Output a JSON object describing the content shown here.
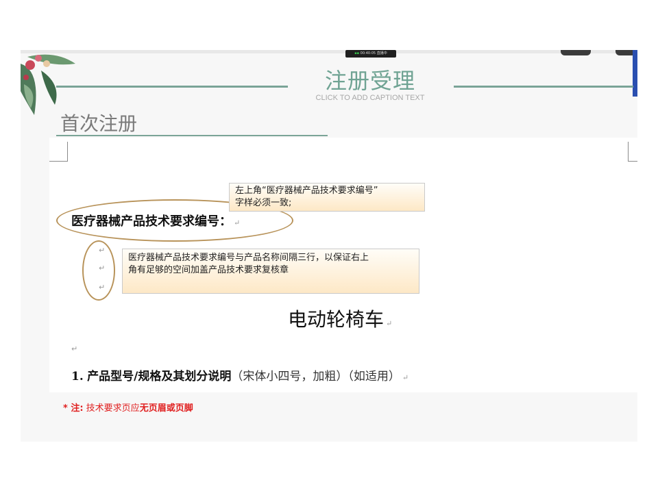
{
  "recording": {
    "time": "00:40:05",
    "status": "直播中"
  },
  "header": {
    "title": "注册受理",
    "caption": "CLICK TO ADD CAPTION TEXT",
    "subtitle": "首次注册"
  },
  "document": {
    "heading": "医疗器械产品技术要求编号：",
    "product_name": "电动轮椅车",
    "section_number": "1.",
    "section_title": "产品型号/规格及其划分说明",
    "section_note": "（宋体小四号，加粗）（如适用）",
    "return_mark": "↵"
  },
  "callouts": {
    "top_line1": "左上角“医疗器械产品技术要求编号”",
    "top_line2": "字样必须一致;",
    "middle_line1": "医疗器械产品技术要求编号与产品名称间隔三行，以保证右上",
    "middle_line2": "角有足够的空间加盖产品技术要求复核章"
  },
  "footnote": {
    "prefix": "* 注:",
    "text": "技术要求页应",
    "emphasis": "无页眉或页脚"
  },
  "colors": {
    "accent_green": "#6fa393",
    "annotation_brown": "#b8935a",
    "note_red": "#e02020"
  }
}
